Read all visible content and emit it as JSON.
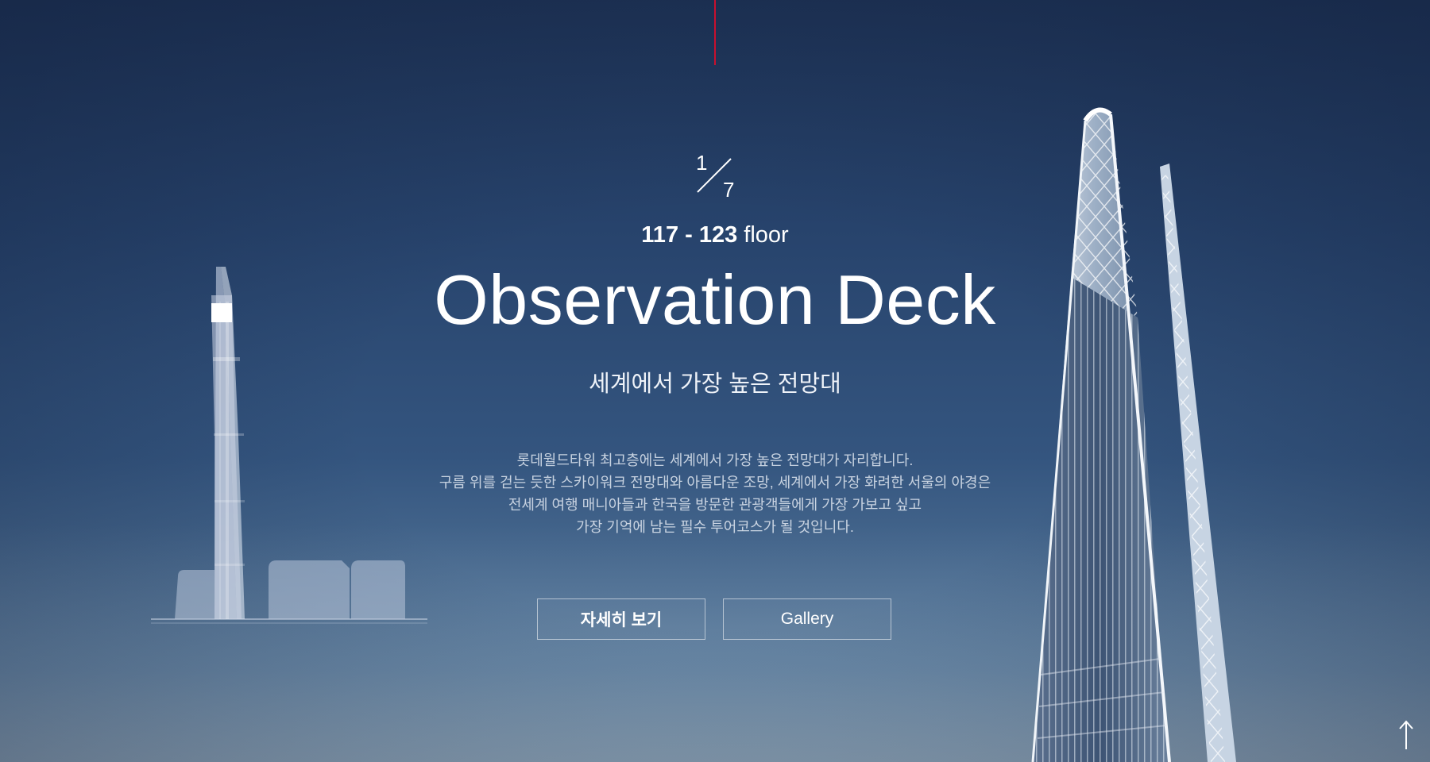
{
  "page": {
    "counter": {
      "current": "1",
      "total": "7"
    },
    "floor": {
      "range": "117 - 123",
      "unit": "floor"
    },
    "title": "Observation Deck",
    "subtitle": "세계에서 가장 높은 전망대",
    "description": [
      "롯데월드타워 최고층에는 세계에서 가장 높은 전망대가 자리합니다.",
      "구름 위를 걷는 듯한 스카이워크 전망대와 아름다운 조망, 세계에서 가장 화려한 서울의 야경은",
      "전세계 여행 매니아들과 한국을 방문한 관광객들에게 가장 가보고 싶고",
      "가장 기억에 남는 필수 투어코스가 될 것입니다."
    ],
    "buttons": {
      "detail": "자세히 보기",
      "gallery": "Gallery"
    }
  },
  "icons": [
    "tower-illustration-icon",
    "scroll-top-arrow-icon"
  ],
  "colors": {
    "accent": "#c8102e",
    "background_top": "#1f3559",
    "background_bottom": "#7d96aa"
  }
}
